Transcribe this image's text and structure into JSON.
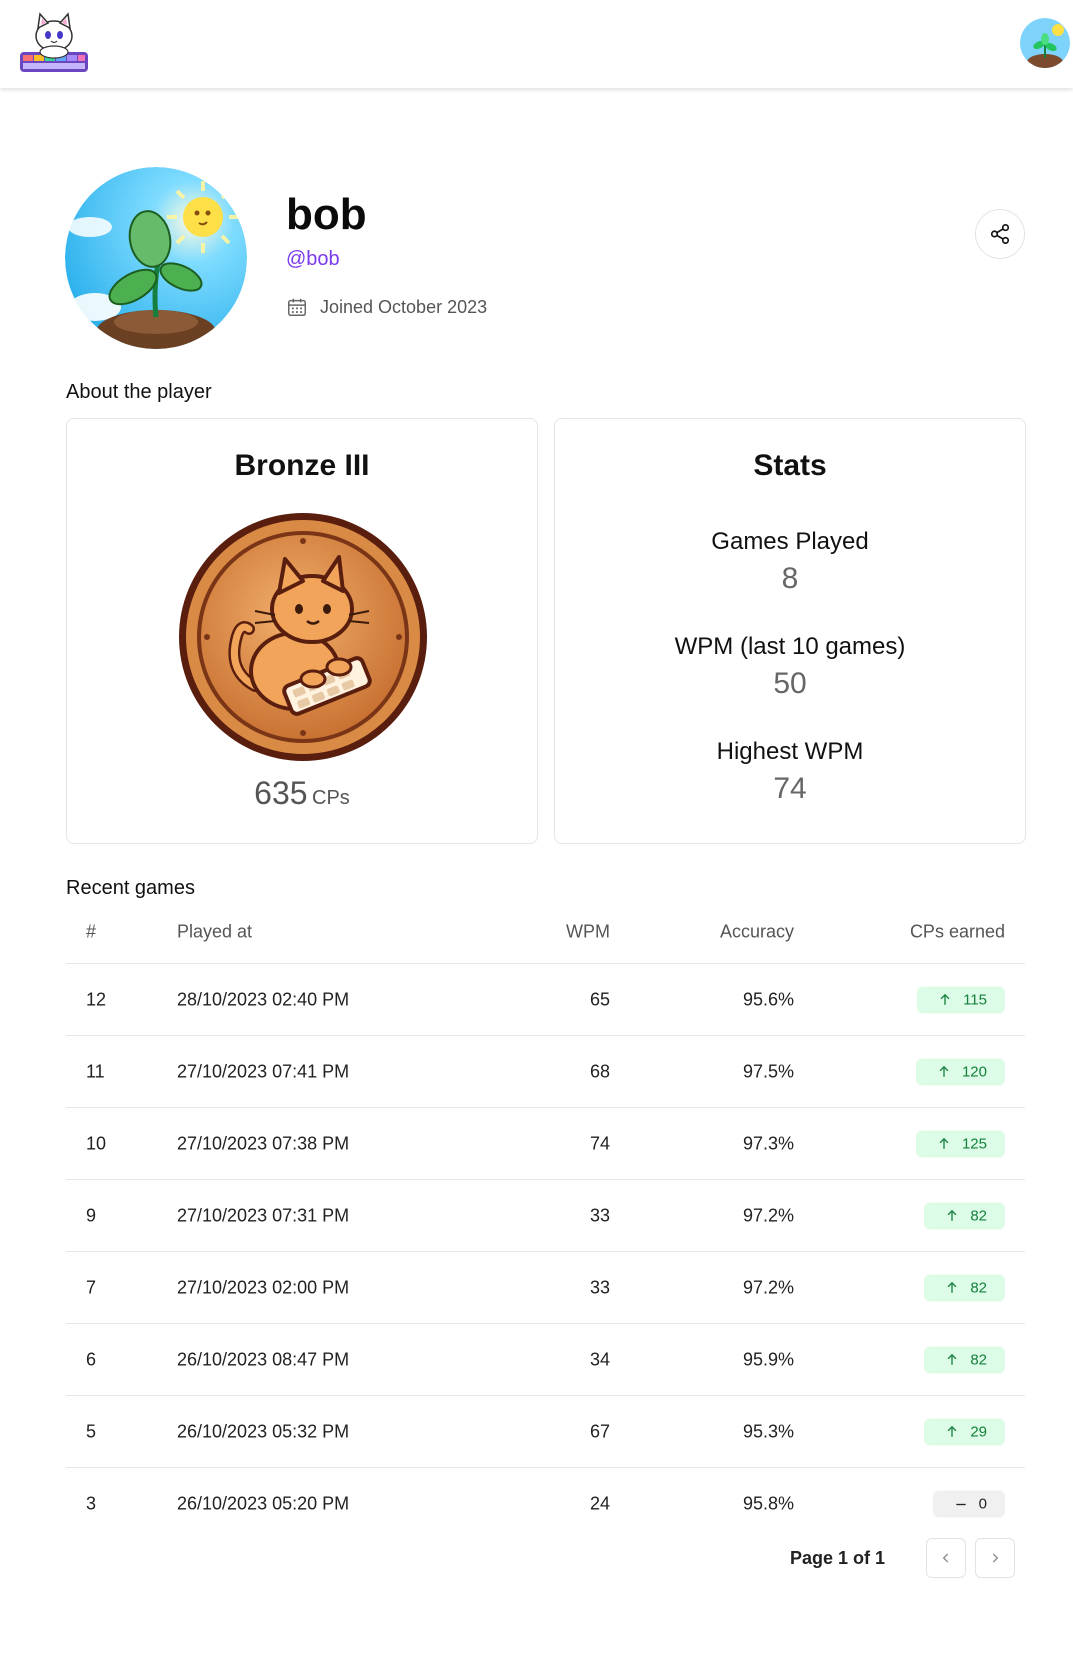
{
  "profile": {
    "display_name": "bob",
    "handle": "@bob",
    "joined": "Joined October 2023"
  },
  "about": {
    "title": "About the player",
    "rank": {
      "title": "Bronze III",
      "cps_value": "635",
      "cps_unit": "CPs"
    },
    "stats": {
      "title": "Stats",
      "items": [
        {
          "label": "Games Played",
          "value": "8"
        },
        {
          "label": "WPM (last 10 games)",
          "value": "50"
        },
        {
          "label": "Highest WPM",
          "value": "74"
        }
      ]
    }
  },
  "recent_games": {
    "title": "Recent games",
    "columns": [
      "#",
      "Played at",
      "WPM",
      "Accuracy",
      "CPs earned"
    ],
    "rows": [
      {
        "num": "12",
        "played_at": "28/10/2023 02:40 PM",
        "wpm": "65",
        "accuracy": "95.6%",
        "cps": "115",
        "trend": "up"
      },
      {
        "num": "11",
        "played_at": "27/10/2023 07:41 PM",
        "wpm": "68",
        "accuracy": "97.5%",
        "cps": "120",
        "trend": "up"
      },
      {
        "num": "10",
        "played_at": "27/10/2023 07:38 PM",
        "wpm": "74",
        "accuracy": "97.3%",
        "cps": "125",
        "trend": "up"
      },
      {
        "num": "9",
        "played_at": "27/10/2023 07:31 PM",
        "wpm": "33",
        "accuracy": "97.2%",
        "cps": "82",
        "trend": "up"
      },
      {
        "num": "7",
        "played_at": "27/10/2023 02:00 PM",
        "wpm": "33",
        "accuracy": "97.2%",
        "cps": "82",
        "trend": "up"
      },
      {
        "num": "6",
        "played_at": "26/10/2023 08:47 PM",
        "wpm": "34",
        "accuracy": "95.9%",
        "cps": "82",
        "trend": "up"
      },
      {
        "num": "5",
        "played_at": "26/10/2023 05:32 PM",
        "wpm": "67",
        "accuracy": "95.3%",
        "cps": "29",
        "trend": "up"
      },
      {
        "num": "3",
        "played_at": "26/10/2023 05:20 PM",
        "wpm": "24",
        "accuracy": "95.8%",
        "cps": "0",
        "trend": "flat"
      }
    ]
  },
  "pagination": {
    "label": "Page 1 of 1"
  },
  "icons": {
    "share": "share-icon",
    "calendar": "calendar-icon",
    "prev": "chevron-left-icon",
    "next": "chevron-right-icon",
    "up": "arrow-up-icon",
    "flat": "minus-icon"
  },
  "colors": {
    "accent": "#7c3aed",
    "gain_bg": "#dcfce7",
    "gain_fg": "#15803d",
    "bronze": "#c8773a"
  }
}
